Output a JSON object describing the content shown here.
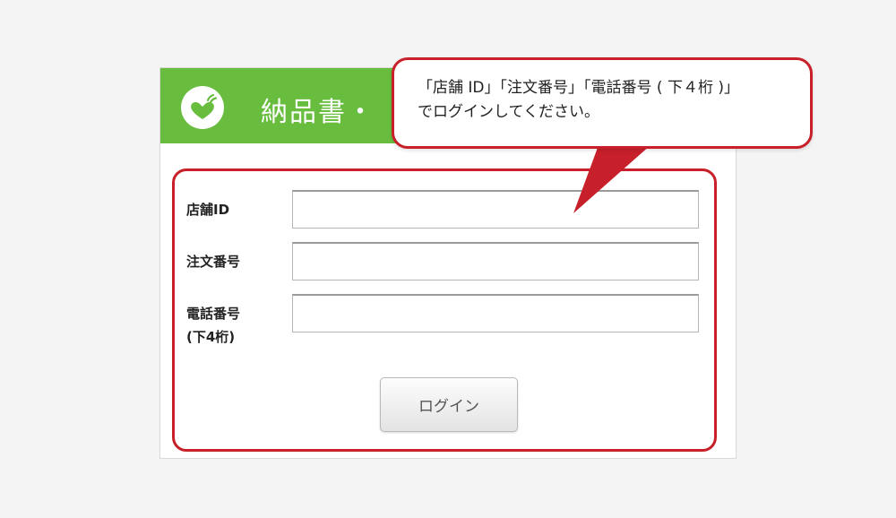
{
  "header": {
    "title": "納品書・"
  },
  "form": {
    "fields": [
      {
        "label": "店舗ID",
        "value": "",
        "placeholder": ""
      },
      {
        "label": "注文番号",
        "value": "",
        "placeholder": ""
      },
      {
        "label_line1": "電話番号",
        "label_line2": "(下4桁)",
        "value": "",
        "placeholder": ""
      }
    ],
    "login_label": "ログイン"
  },
  "callout": {
    "line1": "「店舗 ID」「注文番号」「電話番号 ( 下４桁 )」",
    "line2": "でログインしてください。"
  },
  "colors": {
    "header_green": "#68bd3f",
    "highlight_red": "#c8202a",
    "page_background": "#f5f4f5"
  },
  "icons": {
    "logo": "heart-leaf-logo-icon"
  }
}
